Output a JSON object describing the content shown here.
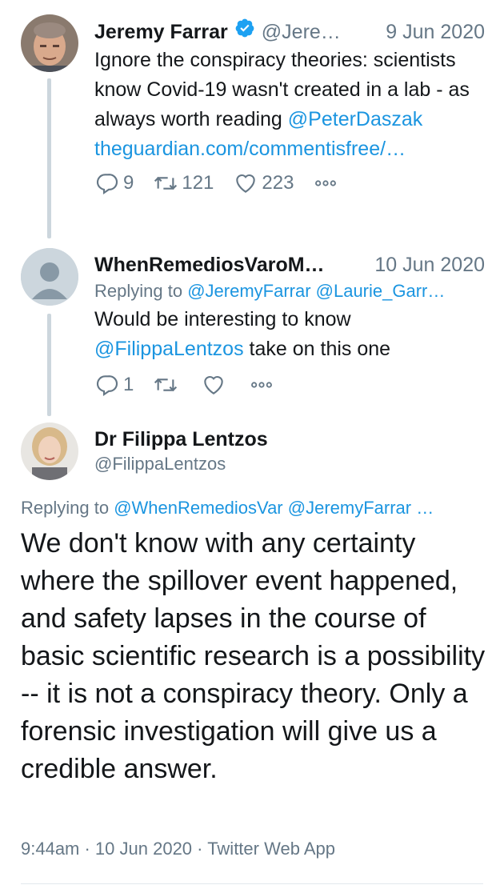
{
  "tweets": [
    {
      "name": "Jeremy Farrar",
      "handle": "@Jere…",
      "date": "9 Jun 2020",
      "text_before": "Ignore the conspiracy theories: scientists know Covid-19 wasn't created in a lab - as always worth reading ",
      "mention": "@PeterDaszak",
      "link": "theguardian.com/commentisfree/…",
      "replies": "9",
      "retweets": "121",
      "likes": "223"
    },
    {
      "name": "WhenRemediosVaroM…",
      "date": "10 Jun 2020",
      "replying_prefix": "Replying to ",
      "replying_to": "@JeremyFarrar @Laurie_Garr…",
      "text_line1": "Would be interesting to know",
      "mention": "@FilippaLentzos",
      "text_after": " take on this one",
      "replies": "1"
    }
  ],
  "main": {
    "name": "Dr Filippa Lentzos",
    "handle": "@FilippaLentzos",
    "replying_prefix": "Replying to ",
    "replying_to": "@WhenRemediosVar @JeremyFarrar …",
    "text": "We don't know with any certainty where the spillover event happened, and safety lapses in the course of basic scientific research is a possibility -- it is not a conspiracy theory. Only a forensic investigation will give us a credible answer.",
    "meta": "9:44am · 10 Jun 2020 · Twitter Web App"
  },
  "icons": {
    "reply": "reply-icon",
    "retweet": "retweet-icon",
    "like": "heart-icon",
    "more": "more-icon",
    "verified": "verified-badge-icon"
  },
  "colors": {
    "link": "#1b95e0",
    "muted": "#657786",
    "verified": "#1da1f2"
  }
}
